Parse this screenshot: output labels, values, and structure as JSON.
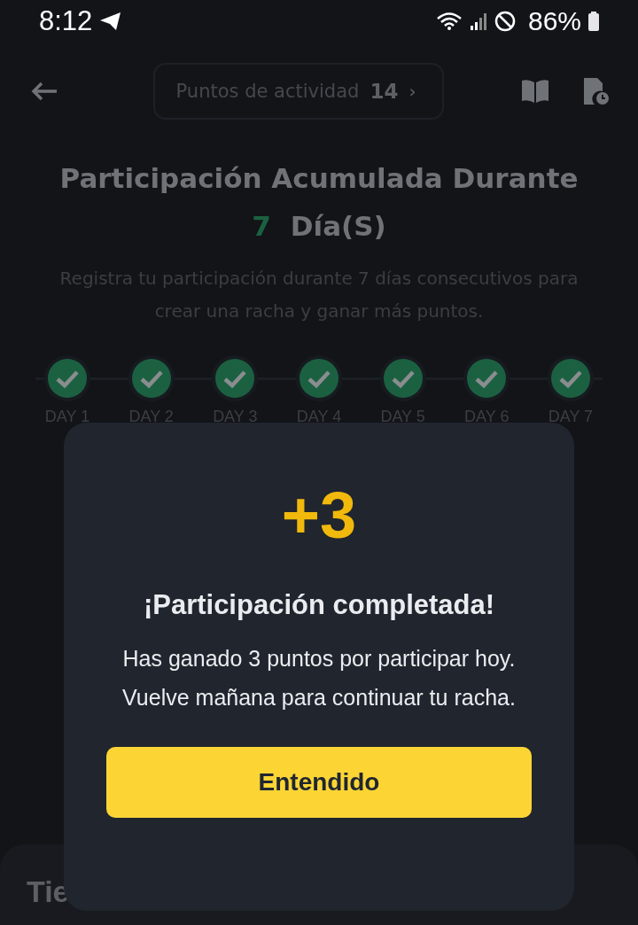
{
  "status_bar": {
    "time": "8:12",
    "battery": "86%"
  },
  "nav": {
    "points_label": "Puntos de actividad",
    "points_value": "14",
    "chevron": "›"
  },
  "title": {
    "line1": "Participación Acumulada Durante",
    "count": "7",
    "unit": "Día(S)"
  },
  "subtitle": "Registra tu participación durante 7 días consecutivos para crear una racha y ganar más puntos.",
  "days": [
    {
      "label": "DAY 1",
      "checked": true
    },
    {
      "label": "DAY 2",
      "checked": true
    },
    {
      "label": "DAY 3",
      "checked": true
    },
    {
      "label": "DAY 4",
      "checked": true
    },
    {
      "label": "DAY 5",
      "checked": true
    },
    {
      "label": "DAY 6",
      "checked": true
    },
    {
      "label": "DAY 7",
      "checked": true
    }
  ],
  "bottom_sheet": {
    "heading": "Tie"
  },
  "dialog": {
    "reward": "+3",
    "title": "¡Participación completada!",
    "message": "Has ganado 3 puntos por participar hoy. Vuelve mañana para continuar tu racha.",
    "button": "Entendido"
  }
}
